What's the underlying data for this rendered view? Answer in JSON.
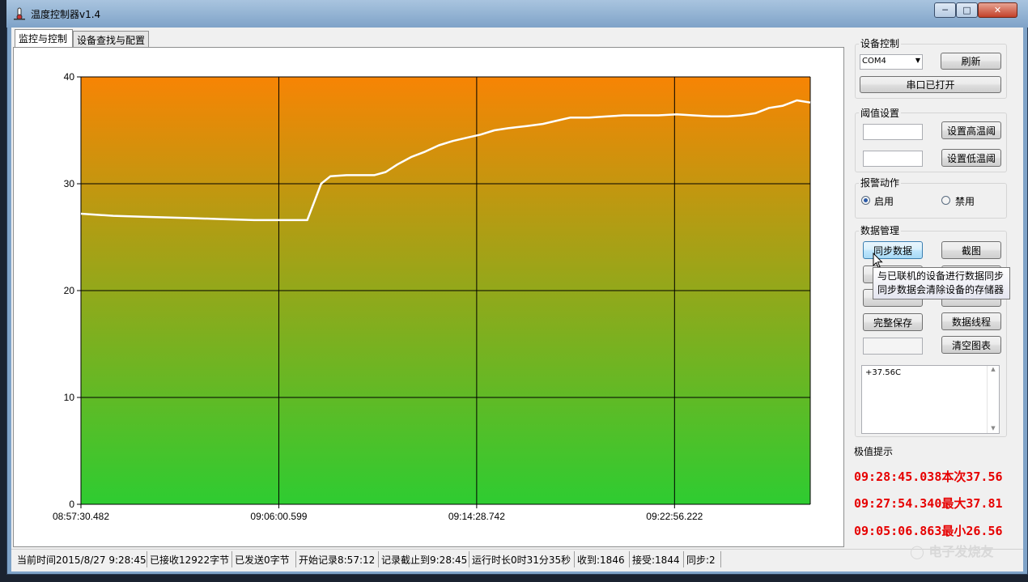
{
  "window": {
    "title": "温度控制器v1.4"
  },
  "tabs": [
    {
      "label": "监控与控制"
    },
    {
      "label": "设备查找与配置"
    }
  ],
  "chart_data": {
    "type": "line",
    "xlabel": "",
    "ylabel": "",
    "ylim": [
      0,
      40
    ],
    "yticks": [
      "0",
      "10",
      "20",
      "30",
      "40"
    ],
    "xticks": [
      "08:57:30.482",
      "09:06:00.599",
      "09:14:28.742",
      "09:22:56.222"
    ],
    "xlim_minutes": [
      0,
      31.58
    ],
    "grid": true,
    "background_gradient": {
      "top": "#f78404",
      "bottom": "#2ecc31"
    },
    "line_color": "#ffffff",
    "series": [
      {
        "x_minutes": [
          0,
          1.4,
          2.8,
          4.5,
          6.0,
          7.5,
          8.5,
          9.4,
          9.8,
          10.1,
          10.4,
          10.8,
          11.5,
          12.7,
          13.2,
          13.7,
          14.3,
          14.9,
          15.5,
          16.1,
          16.7,
          17.3,
          17.9,
          18.5,
          19.3,
          20.0,
          20.6,
          21.2,
          22.0,
          22.8,
          23.5,
          24.3,
          25.0,
          25.8,
          26.5,
          27.3,
          28.0,
          28.6,
          29.2,
          29.8,
          30.4,
          31.0,
          31.58
        ],
        "y": [
          27.2,
          27.0,
          26.9,
          26.8,
          26.7,
          26.6,
          26.6,
          26.6,
          26.6,
          28.3,
          30.0,
          30.7,
          30.8,
          30.8,
          31.1,
          31.8,
          32.5,
          33.0,
          33.6,
          34.0,
          34.3,
          34.6,
          35.0,
          35.2,
          35.4,
          35.6,
          35.9,
          36.2,
          36.2,
          36.3,
          36.4,
          36.4,
          36.4,
          36.5,
          36.4,
          36.3,
          36.3,
          36.4,
          36.6,
          37.1,
          37.3,
          37.8,
          37.6
        ]
      }
    ]
  },
  "device_control": {
    "title": "设备控制",
    "port_value": "COM4",
    "refresh_label": "刷新",
    "open_port_label": "串口已打开"
  },
  "threshold": {
    "title": "阈值设置",
    "high_value": "",
    "low_value": "",
    "set_high_label": "设置高温阈",
    "set_low_label": "设置低温阈"
  },
  "alarm": {
    "title": "报警动作",
    "enable_label": "启用",
    "disable_label": "禁用",
    "selected": "启用"
  },
  "data_mgmt": {
    "title": "数据管理",
    "sync_label": "同步数据",
    "screenshot_label": "截图",
    "full_save_label": "完整保存",
    "data_curve_label": "数据线程",
    "clear_chart_label": "清空图表",
    "log_text": "+37.56C"
  },
  "tooltip": {
    "line1": "与已联机的设备进行数据同步",
    "line2": "同步数据会清除设备的存储器"
  },
  "extremes": {
    "title": "极值提示",
    "current": "09:28:45.038本次37.56",
    "max": "09:27:54.340最大37.81",
    "min": "09:05:06.863最小26.56",
    "color": "#e60000"
  },
  "statusbar": {
    "current_time": "当前时间2015/8/27 9:28:45",
    "received_bytes": "已接收12922字节",
    "sent_bytes": "已发送0字节",
    "record_start": "开始记录8:57:12",
    "record_until": "记录截止到9:28:45",
    "run_time": "运行时长0时31分35秒",
    "recv_count": "收到:1846",
    "accept_count": "接受:1844",
    "sync_count": "同步:2"
  },
  "watermark": "电子发烧友"
}
